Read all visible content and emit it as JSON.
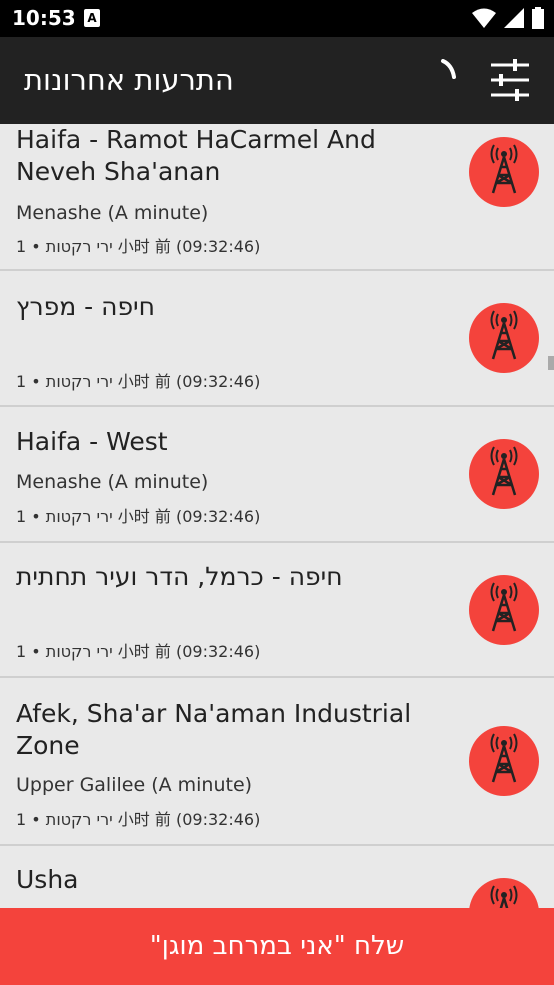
{
  "status_bar": {
    "time": "10:53",
    "notif_glyph": "A"
  },
  "app_bar": {
    "title": "התרעות אחרונות"
  },
  "alerts": [
    {
      "city": "Haifa - Ramot HaCarmel And Neveh Sha'anan",
      "area": "Menashe (A minute)",
      "time_line": "ירי רקטות • 1 小时 前 (09:32:46)"
    },
    {
      "city": "חיפה - מפרץ",
      "area": "",
      "time_line": "ירי רקטות • 1 小时 前 (09:32:46)"
    },
    {
      "city": "Haifa - West",
      "area": "Menashe (A minute)",
      "time_line": "ירי רקטות • 1 小时 前 (09:32:46)"
    },
    {
      "city": "חיפה - כרמל, הדר ועיר תחתית",
      "area": "",
      "time_line": "ירי רקטות • 1 小时 前 (09:32:46)"
    },
    {
      "city": "Afek, Sha'ar Na'aman Industrial Zone",
      "area": "Upper Galilee (A minute)",
      "time_line": "ירי רקטות • 1 小时 前 (09:32:46)"
    },
    {
      "city": "Usha",
      "area": "",
      "time_line": ""
    }
  ],
  "bottom_button": {
    "label": "שלח \"אני במרחב מוגן\""
  },
  "colors": {
    "accent": "#f4433c",
    "app_bar": "#222222",
    "background": "#e9e9e9"
  },
  "icons": {
    "alert": "radio-tower-icon",
    "filter": "sliders-icon",
    "loading": "spinner-icon"
  }
}
